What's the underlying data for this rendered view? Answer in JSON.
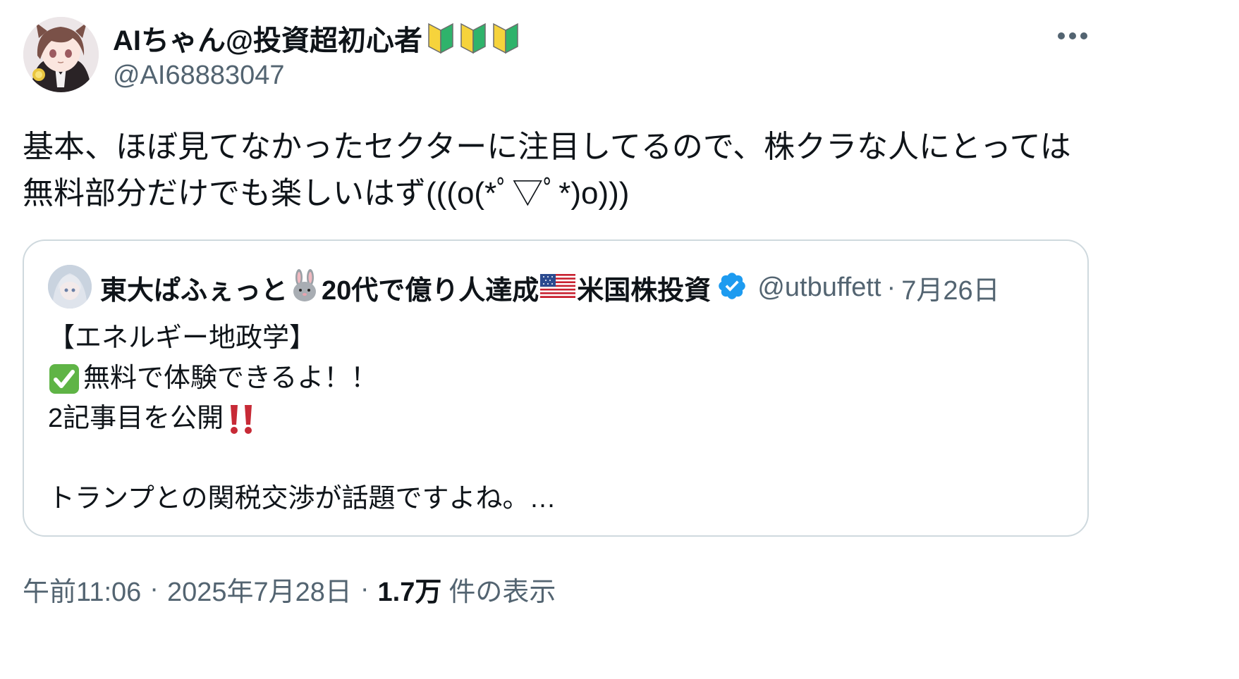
{
  "author": {
    "display_name": "AIちゃん@投資超初心者",
    "handle": "@AI68883047",
    "badges": [
      "beginner-mark-icon",
      "beginner-mark-icon",
      "beginner-mark-icon"
    ],
    "avatar": "anime-girl-avatar"
  },
  "tweet": {
    "text": "基本、ほぼ見てなかったセクターに注目してるので、株クラな人にとっては無料部分だけでも楽しいはず(((o(*ﾟ▽ﾟ*)o)))"
  },
  "quote": {
    "name_part1": "東大ぱふぇっと",
    "name_part2": "20代で億り人達成",
    "name_part3": "米国株投資",
    "name_icons": [
      "rabbit-icon",
      "us-flag-icon",
      "verified-badge-icon"
    ],
    "handle": "@utbuffett",
    "separator": "·",
    "date": "7月26日",
    "lines": [
      "【エネルギー地政学】",
      "無料で体験できるよ！！",
      "2記事目を公開",
      "",
      "トランプとの関税交渉が話題ですよね。…"
    ]
  },
  "meta": {
    "time": "午前11:06",
    "separator": "·",
    "date": "2025年7月28日",
    "views_count": "1.7万",
    "views_label": "件の表示"
  },
  "colors": {
    "text_primary": "#0f1419",
    "text_secondary": "#536471",
    "border": "#cfd9de",
    "verified_blue": "#1d9bf0",
    "beginner_green": "#2fb36b",
    "beginner_yellow": "#f6d33c",
    "check_green": "#5fb446",
    "bang_red": "#c72a36"
  }
}
